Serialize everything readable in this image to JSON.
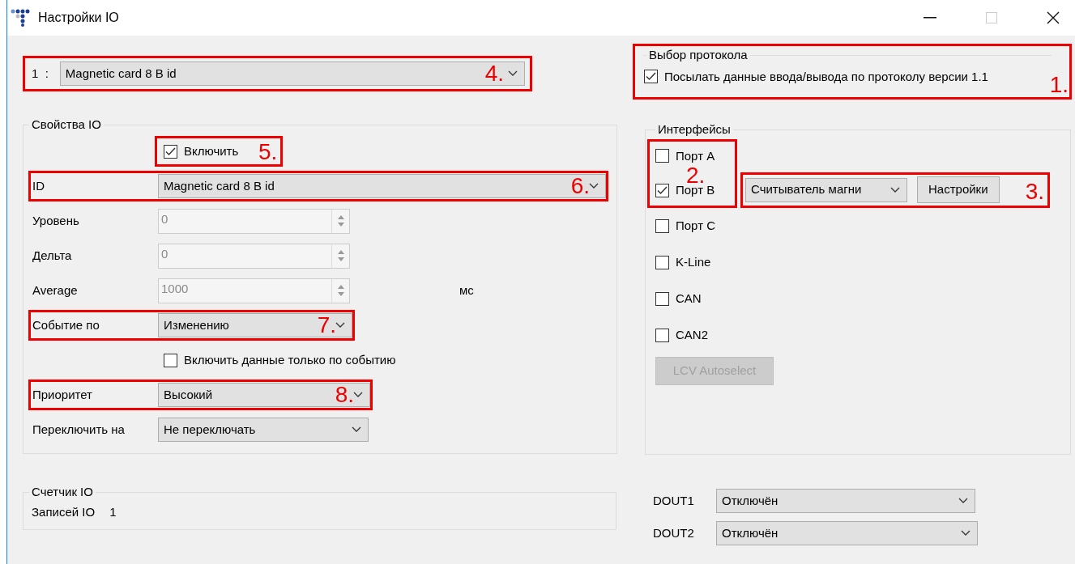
{
  "window": {
    "title": "Настройки IO"
  },
  "io_selector": {
    "index": "1  :",
    "value": "Magnetic card 8 B id",
    "annotation": "4."
  },
  "protocol": {
    "title": "Выбор протокола",
    "label": "Посылать данные ввода/вывода по протоколу версии 1.1",
    "checked": true,
    "annotation": "1."
  },
  "properties": {
    "title": "Свойства IO",
    "rows": [
      {
        "kind": "checkbox",
        "label": "Включить",
        "checked": true,
        "annotation": "5."
      },
      {
        "kind": "select",
        "label": "ID",
        "value": "Magnetic card 8 B id",
        "annotation": "6."
      },
      {
        "kind": "spinner",
        "label": "Уровень",
        "value": "0",
        "disabled": true
      },
      {
        "kind": "spinner",
        "label": "Дельта",
        "value": "0",
        "disabled": true
      },
      {
        "kind": "spinner",
        "label": "Average",
        "value": "1000",
        "disabled": true,
        "unit": "мс"
      },
      {
        "kind": "select",
        "label": "Событие по",
        "value": "Изменению",
        "annotation": "7."
      },
      {
        "kind": "checkbox",
        "label": "Включить данные только по событию",
        "checked": false
      },
      {
        "kind": "select",
        "label": "Приоритет",
        "value": "Высокий",
        "annotation": "8."
      },
      {
        "kind": "select",
        "label": "Переключить на",
        "value": "Не переключать"
      }
    ]
  },
  "interfaces": {
    "title": "Интерфейсы",
    "port_group": {
      "annotation": "2.",
      "ports": [
        {
          "label": "Порт A",
          "checked": false
        },
        {
          "label": "Порт B",
          "checked": true
        }
      ]
    },
    "reader": {
      "annotation": "3.",
      "value": "Считыватель магни",
      "button": "Настройки"
    },
    "ports": [
      {
        "label": "Порт C",
        "checked": false
      },
      {
        "label": "K-Line",
        "checked": false
      },
      {
        "label": "CAN",
        "checked": false
      },
      {
        "label": "CAN2",
        "checked": false
      }
    ],
    "autoselect": {
      "label": "LCV Autoselect",
      "disabled": true
    }
  },
  "counter": {
    "title": "Счетчик IO",
    "label": "Записей IO",
    "value": "1"
  },
  "outputs": [
    {
      "label": "DOUT1",
      "value": "Отключён"
    },
    {
      "label": "DOUT2",
      "value": "Отключён"
    }
  ]
}
